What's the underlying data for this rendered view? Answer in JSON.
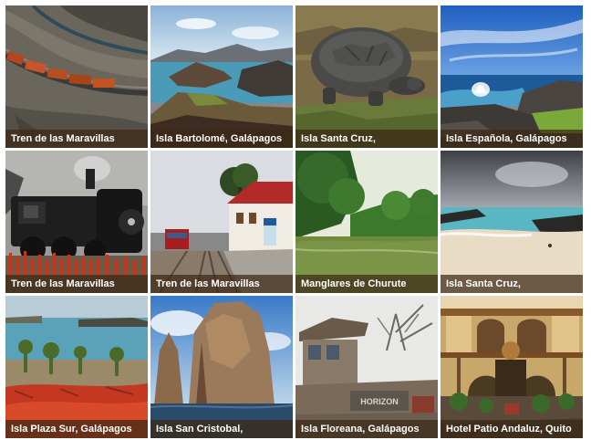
{
  "gallery": {
    "items": [
      {
        "caption": "Tren de las Maravillas"
      },
      {
        "caption": "Isla Bartolomé, Galápagos"
      },
      {
        "caption": "Isla Santa Cruz,"
      },
      {
        "caption": "Isla Española, Galápagos"
      },
      {
        "caption": "Tren de las Maravillas"
      },
      {
        "caption": "Tren de las Maravillas"
      },
      {
        "caption": "Manglares de Churute"
      },
      {
        "caption": "Isla Santa Cruz,"
      },
      {
        "caption": "Isla Plaza Sur, Galápagos"
      },
      {
        "caption": "Isla San Cristobal,"
      },
      {
        "caption": "Isla Floreana, Galápagos"
      },
      {
        "caption": "Hotel Patio Andaluz, Quito"
      }
    ],
    "sign_text": "HORIZON"
  }
}
